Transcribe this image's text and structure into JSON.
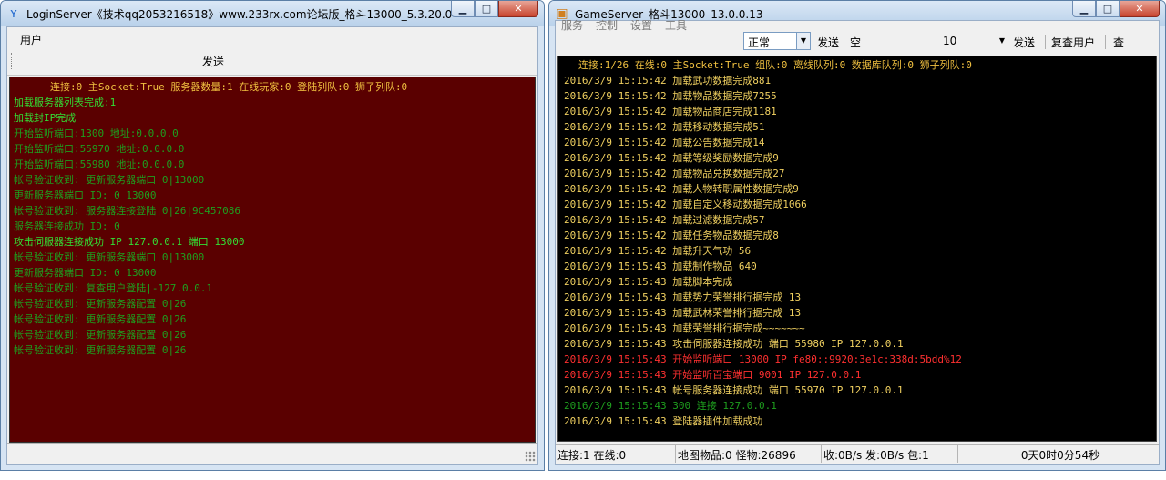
{
  "login_window": {
    "title": "LoginServer《技术qq2053216518》www.233rx.com论坛版_格斗13000_5.3.20.0",
    "icon": "yy-logo-icon",
    "menu": [
      "用户"
    ],
    "send_label": "发送",
    "log": [
      {
        "text": "连接:0 主Socket:True 服务器数量:1 在线玩家:0 登陆列队:0 狮子列队:0",
        "color": "#f0c040"
      },
      {
        "text": "加载服务器列表完成:1",
        "color": "#33dd33"
      },
      {
        "text": "加载封IP完成",
        "color": "#33dd33"
      },
      {
        "text": "开始监听端口:1300 地址:0.0.0.0",
        "color": "#1e9e1e"
      },
      {
        "text": "开始监听端口:55970 地址:0.0.0.0",
        "color": "#1e9e1e"
      },
      {
        "text": "开始监听端口:55980 地址:0.0.0.0",
        "color": "#1e9e1e"
      },
      {
        "text": "帐号验证收到: 更新服务器端口|0|13000",
        "color": "#1e9e1e"
      },
      {
        "text": "更新服务器端口 ID: 0   13000",
        "color": "#1e9e1e"
      },
      {
        "text": "帐号验证收到: 服务器连接登陆|0|26|9C457086",
        "color": "#1e9e1e"
      },
      {
        "text": "服务器连接成功 ID: 0",
        "color": "#1e9e1e"
      },
      {
        "text": "攻击伺服器连接成功 IP 127.0.0.1 端口 13000",
        "color": "#33dd33"
      },
      {
        "text": "帐号验证收到: 更新服务器端口|0|13000",
        "color": "#1e9e1e"
      },
      {
        "text": "更新服务器端口 ID: 0   13000",
        "color": "#1e9e1e"
      },
      {
        "text": "帐号验证收到: 复查用户登陆|-127.0.0.1",
        "color": "#1e9e1e"
      },
      {
        "text": "帐号验证收到: 更新服务器配置|0|26",
        "color": "#1e9e1e"
      },
      {
        "text": "帐号验证收到: 更新服务器配置|0|26",
        "color": "#1e9e1e"
      },
      {
        "text": "帐号验证收到: 更新服务器配置|0|26",
        "color": "#1e9e1e"
      },
      {
        "text": "帐号验证收到: 更新服务器配置|0|26",
        "color": "#1e9e1e"
      }
    ]
  },
  "game_window": {
    "title": "GameServer_格斗13000_13.0.0.13",
    "icon": "server-icon",
    "menu": [
      "服务",
      "控制",
      "设置",
      "工具"
    ],
    "toolbar": {
      "mode_value": "正常",
      "send1_label": "发送",
      "field_value": "空",
      "count_value": "10",
      "send2_label": "发送",
      "recheck_label": "复查用户",
      "query_label": "查"
    },
    "log": [
      {
        "text": "连接:1/26 在线:0 主Socket:True 组队:0 离线队列:0 数据库队列:0 狮子列队:0",
        "color": "#f0c040"
      },
      {
        "text": "2016/3/9  15:15:42 加载武功数据完成881",
        "color": "#f0d060"
      },
      {
        "text": "2016/3/9  15:15:42 加载物品数据完成7255",
        "color": "#f0d060"
      },
      {
        "text": "2016/3/9  15:15:42 加载物品商店完成1181",
        "color": "#f0d060"
      },
      {
        "text": "2016/3/9  15:15:42 加载移动数据完成51",
        "color": "#f0d060"
      },
      {
        "text": "2016/3/9  15:15:42 加载公告数据完成14",
        "color": "#f0d060"
      },
      {
        "text": "2016/3/9  15:15:42 加载等级奖励数据完成9",
        "color": "#f0d060"
      },
      {
        "text": "2016/3/9  15:15:42 加载物品兑换数据完成27",
        "color": "#f0d060"
      },
      {
        "text": "2016/3/9  15:15:42 加载人物转职属性数据完成9",
        "color": "#f0d060"
      },
      {
        "text": "2016/3/9  15:15:42 加载自定义移动数据完成1066",
        "color": "#f0d060"
      },
      {
        "text": "2016/3/9  15:15:42 加载过滤数据完成57",
        "color": "#f0d060"
      },
      {
        "text": "2016/3/9  15:15:42 加载任务物品数据完成8",
        "color": "#f0d060"
      },
      {
        "text": "2016/3/9  15:15:42 加载升天气功 56",
        "color": "#f0d060"
      },
      {
        "text": "2016/3/9  15:15:43 加载制作物品 640",
        "color": "#f0d060"
      },
      {
        "text": "2016/3/9  15:15:43 加载脚本完成",
        "color": "#f0d060"
      },
      {
        "text": "2016/3/9  15:15:43 加载势力荣誉排行据完成 13",
        "color": "#f0d060"
      },
      {
        "text": "2016/3/9  15:15:43 加载武林荣誉排行据完成 13",
        "color": "#f0d060"
      },
      {
        "text": "2016/3/9  15:15:43 加载荣誉排行据完成~~~~~~~",
        "color": "#f0d060"
      },
      {
        "text": "2016/3/9  15:15:43 攻击伺服器连接成功 端口 55980 IP 127.0.0.1",
        "color": "#f0d060"
      },
      {
        "text": "2016/3/9  15:15:43 开始监听端口 13000 IP fe80::9920:3e1c:338d:5bdd%12",
        "color": "#ff3030"
      },
      {
        "text": "2016/3/9  15:15:43 开始监听百宝端口  9001 IP 127.0.0.1",
        "color": "#ff3030"
      },
      {
        "text": "2016/3/9  15:15:43 帐号服务器连接成功 端口 55970 IP 127.0.0.1",
        "color": "#f0d060"
      },
      {
        "text": "2016/3/9  15:15:43 300 连接 127.0.0.1",
        "color": "#1e9e1e"
      },
      {
        "text": "2016/3/9  15:15:43 登陆器插件加载成功",
        "color": "#f0d060"
      }
    ],
    "status": {
      "conn": "连接:1 在线:0",
      "map": "地图物品:0 怪物:26896",
      "traffic": "收:0B/s 发:0B/s 包:1",
      "uptime": "0天0时0分54秒"
    }
  }
}
